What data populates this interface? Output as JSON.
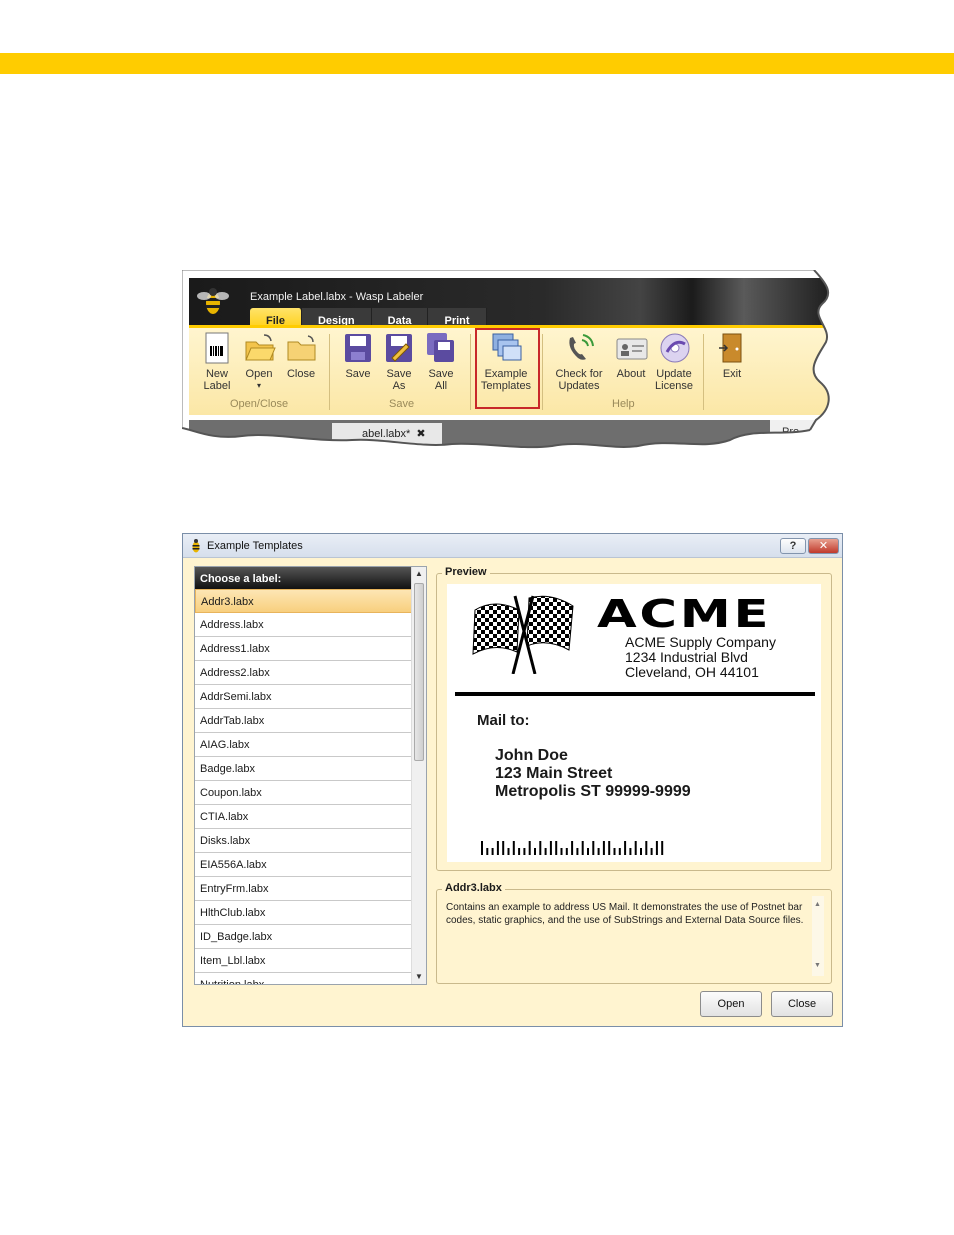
{
  "window": {
    "title": "Example Label.labx - Wasp Labeler"
  },
  "ribbon": {
    "tabs": [
      "File",
      "Design",
      "Data",
      "Print"
    ],
    "buttons": {
      "new_label": "New\nLabel",
      "open": "Open",
      "close": "Close",
      "save": "Save",
      "save_as": "Save\nAs",
      "save_all": "Save\nAll",
      "example_templates": "Example\nTemplates",
      "check_updates": "Check for\nUpdates",
      "about": "About",
      "update_license": "Update\nLicense",
      "exit": "Exit"
    },
    "groups": {
      "open_close": "Open/Close",
      "save": "Save",
      "help": "Help"
    },
    "doc_tab": "abel.labx*",
    "doc_tab_close": "✖",
    "properties_tab": "Pro"
  },
  "dialog": {
    "title": "Example Templates",
    "help_button": "?",
    "close_button": "✕",
    "list_header": "Choose a label:",
    "items": [
      "Addr3.labx",
      "Address.labx",
      "Address1.labx",
      "Address2.labx",
      "AddrSemi.labx",
      "AddrTab.labx",
      "AIAG.labx",
      "Badge.labx",
      "Coupon.labx",
      "CTIA.labx",
      "Disks.labx",
      "EIA556A.labx",
      "EntryFrm.labx",
      "HlthClub.labx",
      "ID_Badge.labx",
      "Item_Lbl.labx",
      "Nutrition.labx"
    ],
    "selected_index": 0,
    "preview_legend": "Preview",
    "preview": {
      "logo": "ACME",
      "company": "ACME Supply Company",
      "street": "1234 Industrial Blvd",
      "city": "Cleveland, OH  44101",
      "mail_to": "Mail to:",
      "name": "John Doe",
      "address": "123 Main Street",
      "city_state": "Metropolis ST 99999-9999"
    },
    "desc_legend": "Addr3.labx",
    "description": "Contains an example to address US Mail.  It demonstrates the use of Postnet bar codes, static graphics, and the use of SubStrings and External Data Source files.",
    "open_button": "Open",
    "close_button_label": "Close"
  },
  "colors": {
    "accent": "#ffcc00",
    "ribbon_bg": "#fff5cf",
    "highlight": "#c8282a",
    "dialog_bg": "#fff4d0"
  }
}
